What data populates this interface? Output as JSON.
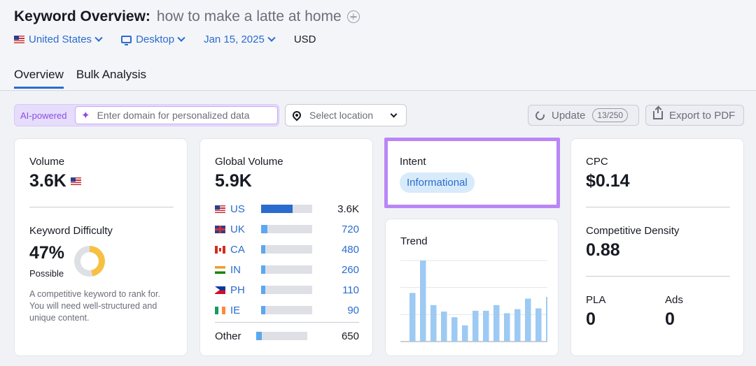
{
  "header": {
    "title": "Keyword Overview:",
    "keyword": "how to make a latte at home",
    "filters": {
      "country": "United States",
      "device": "Desktop",
      "date": "Jan 15, 2025",
      "currency": "USD"
    },
    "tabs": [
      {
        "label": "Overview",
        "active": true
      },
      {
        "label": "Bulk Analysis",
        "active": false
      }
    ]
  },
  "toolbar": {
    "ai_label": "AI-powered",
    "domain_placeholder": "Enter domain for personalized data",
    "location_placeholder": "Select location",
    "update_label": "Update",
    "update_count": "13/250",
    "export_label": "Export to PDF"
  },
  "volume": {
    "label": "Volume",
    "value": "3.6K",
    "kd_label": "Keyword Difficulty",
    "kd_value": "47%",
    "kd_fraction": 0.47,
    "kd_level": "Possible",
    "kd_description": "A competitive keyword to rank for. You will need well-structured and unique content."
  },
  "global": {
    "label": "Global Volume",
    "value": "5.9K",
    "rows": [
      {
        "code": "US",
        "value": "3.6K",
        "fraction": 0.61
      },
      {
        "code": "UK",
        "value": "720",
        "fraction": 0.12
      },
      {
        "code": "CA",
        "value": "480",
        "fraction": 0.08
      },
      {
        "code": "IN",
        "value": "260",
        "fraction": 0.04
      },
      {
        "code": "PH",
        "value": "110",
        "fraction": 0.02
      },
      {
        "code": "IE",
        "value": "90",
        "fraction": 0.02
      }
    ],
    "other_label": "Other",
    "other_value": "650",
    "other_fraction": 0.11
  },
  "intent": {
    "label": "Intent",
    "value": "Informational"
  },
  "trend": {
    "label": "Trend",
    "chart_data": {
      "type": "bar",
      "values": [
        0.6,
        1.0,
        0.45,
        0.37,
        0.3,
        0.2,
        0.38,
        0.38,
        0.45,
        0.35,
        0.4,
        0.53,
        0.41,
        0.55
      ],
      "ylim": [
        0,
        1
      ]
    }
  },
  "cpc": {
    "label": "CPC",
    "value": "$0.14",
    "density_label": "Competitive Density",
    "density_value": "0.88",
    "pla_label": "PLA",
    "pla_value": "0",
    "ads_label": "Ads",
    "ads_value": "0"
  }
}
